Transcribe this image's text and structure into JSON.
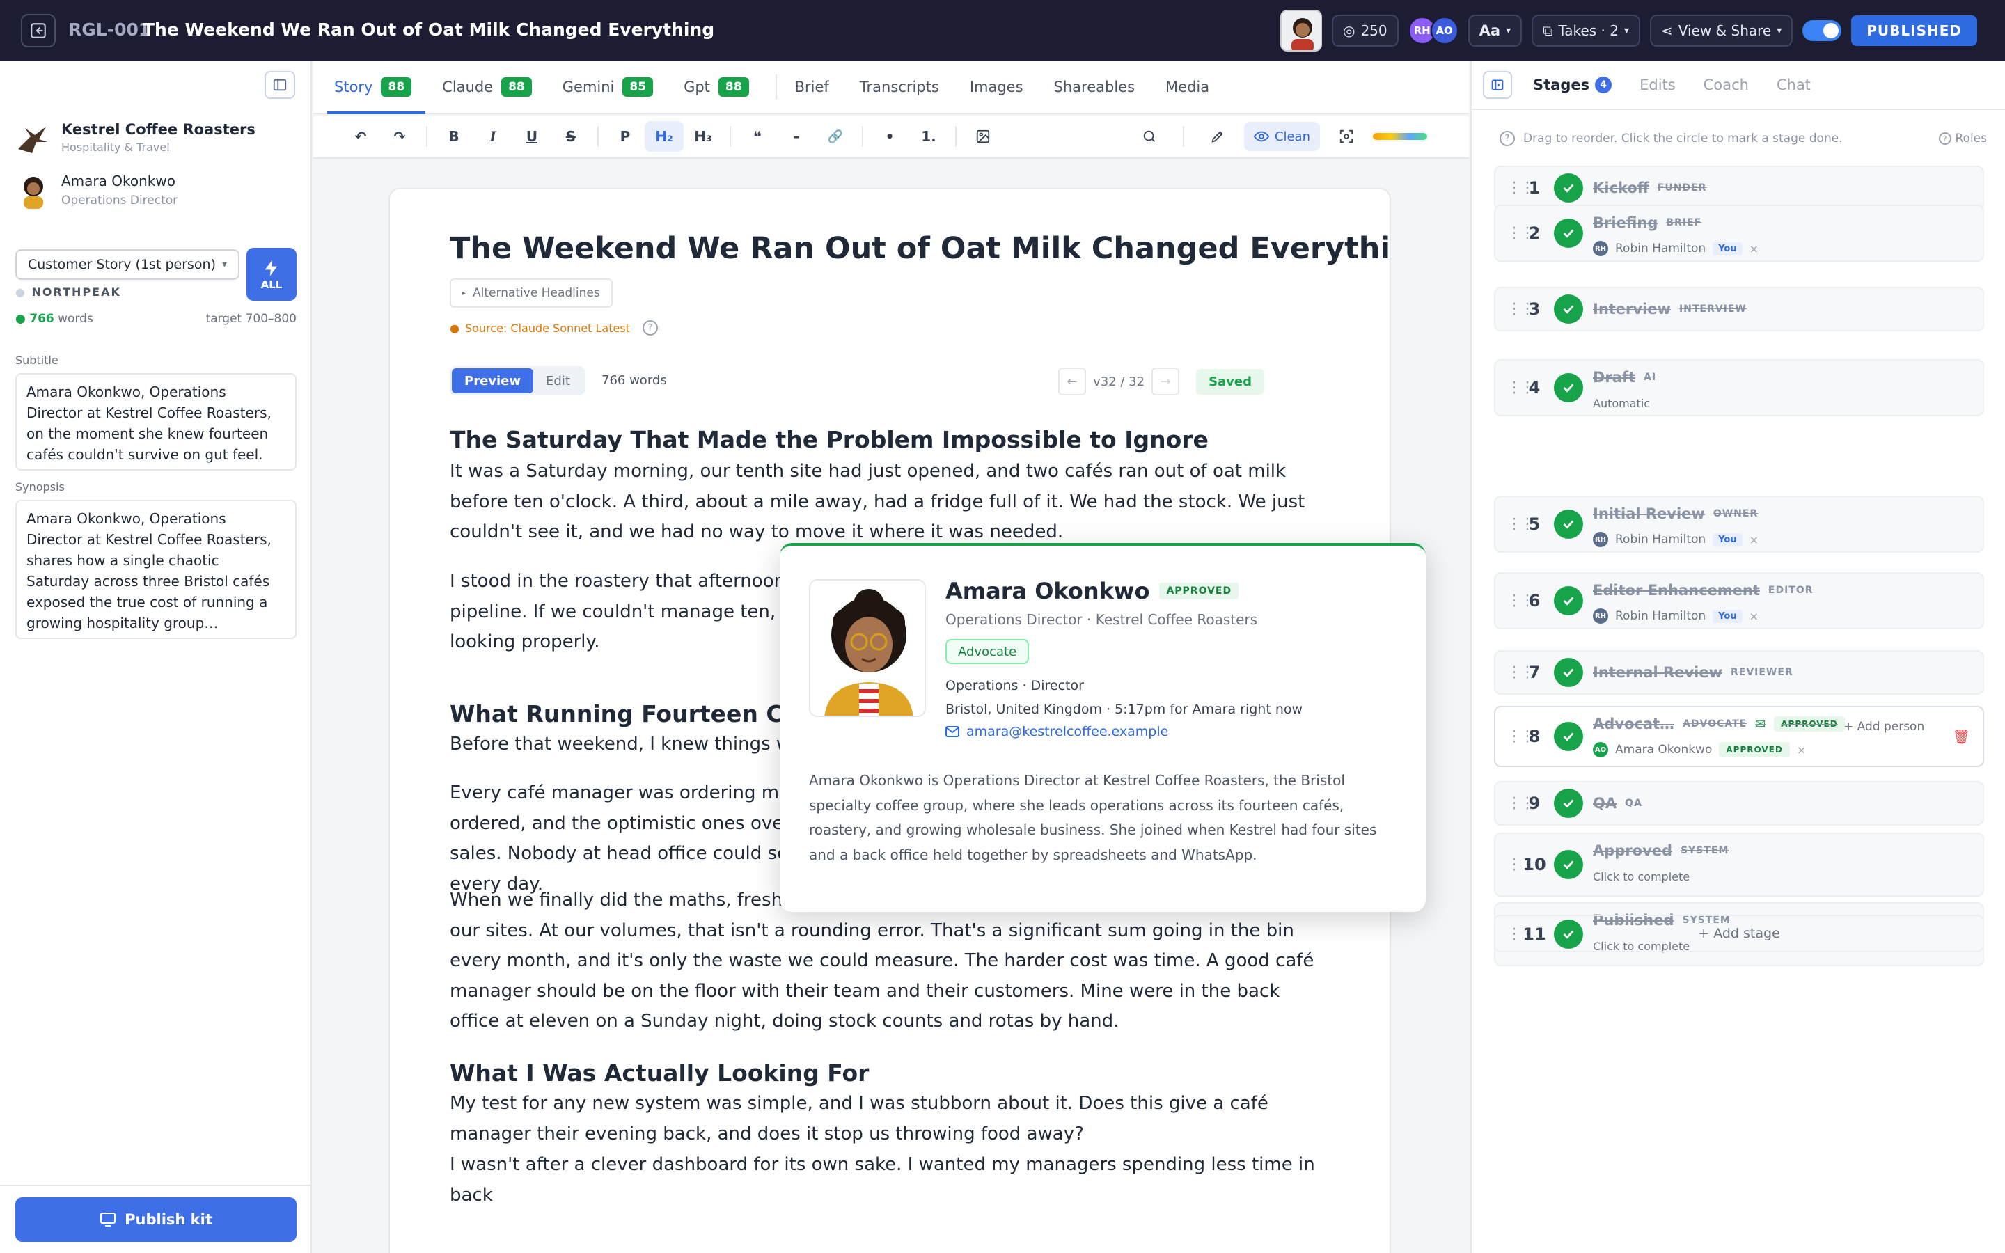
{
  "topbar": {
    "id": "RGL-001",
    "title": "The Weekend We Ran Out of Oat Milk Changed Everything",
    "credits": "250",
    "avatars": [
      "RH",
      "AO"
    ],
    "font_label": "Aa",
    "takes_label": "Takes · 2",
    "share_label": "View & Share",
    "status": "PUBLISHED"
  },
  "sidebar": {
    "org_name": "Kestrel Coffee Roasters",
    "org_sector": "Hospitality & Travel",
    "person_name": "Amara Okonkwo",
    "person_title": "Operations Director",
    "story_type": "Customer Story (1st person)",
    "all_label": "ALL",
    "brand": "NORTHPEAK",
    "word_count": "766",
    "words_label": "words",
    "target": "target 700–800",
    "subtitle_label": "Subtitle",
    "subtitle": "Amara Okonkwo, Operations Director at Kestrel Coffee Roasters, on the moment she knew fourteen cafés couldn't survive on gut feel.",
    "synopsis_label": "Synopsis",
    "synopsis": "Amara Okonkwo, Operations Director at Kestrel Coffee Roasters, shares how a single chaotic Saturday across three Bristol cafés exposed the true cost of running a growing hospitality group…",
    "publish_label": "Publish kit"
  },
  "tabs": [
    {
      "label": "Story",
      "score": "88"
    },
    {
      "label": "Claude",
      "score": "88"
    },
    {
      "label": "Gemini",
      "score": "85"
    },
    {
      "label": "Gpt",
      "score": "88"
    }
  ],
  "subtabs": [
    "Brief",
    "Transcripts",
    "Images",
    "Shareables",
    "Media"
  ],
  "toolbar": {
    "undo": "↶",
    "redo": "↷",
    "bold": "B",
    "italic": "I",
    "underline": "U",
    "strike": "S",
    "para": "P",
    "h2": "H₂",
    "h3": "H₃",
    "quote": "❝",
    "hr": "–",
    "link": "🔗",
    "bullet": "•",
    "ordered": "1.",
    "clean_label": "Clean"
  },
  "doc": {
    "title": "The Weekend We Ran Out of Oat Milk Changed Everything",
    "alt_headlines": "Alternative Headlines",
    "source": "Source: Claude Sonnet Latest",
    "preview_label": "Preview",
    "edit_label": "Edit",
    "word_count": "766 words",
    "version": "v32 / 32",
    "saved": "Saved",
    "h2_1": "The Saturday That Made the Problem Impossible to Ignore",
    "p1": "It was a Saturday morning, our tenth site had just opened, and two cafés ran out of oat milk before ten o'clock. A third, about a mile away, had a fridge full of it. We had the stock. We just couldn't see it, and we had no way to move it where it was needed.",
    "p2": "I stood in the roastery that afternoon and realised that with four more sites already in the pipeline. If we couldn't manage ten, we'd never manage fourteen. That Monday, I started looking properly.",
    "h2_2": "What Running Fourteen Cafés on Gut Feel Actually Cost",
    "p3": "Before that weekend, I knew things weren't right.",
    "p4": "Every café manager was ordering milk and fresh food on instinct. The cautious ones under-ordered, and the optimistic ones over-ordered and threw food away at close. Either way we lost sales. Nobody at head office could see any of it until the waste had already happened, quietly, every day.",
    "p5": "When we finally did the maths, fresh-stock waste was running at over eight percent across all our sites. At our volumes, that isn't a rounding error. That's a significant sum going in the bin every month, and it's only the waste we could measure. The harder cost was time. A good café manager should be on the floor with their team and their customers. Mine were in the back office at eleven on a Sunday night, doing stock counts and rotas by hand.",
    "h2_3": "What I Was Actually Looking For",
    "p6": "My test for any new system was simple, and I was stubborn about it. Does this give a café manager their evening back, and does it stop us throwing food away?",
    "p7": "I wasn't after a clever dashboard for its own sake. I wanted my managers spending less time in back"
  },
  "popup": {
    "name": "Amara Okonkwo",
    "status": "APPROVED",
    "role": "Operations Director · Kestrel Coffee Roasters",
    "tag": "Advocate",
    "dept": "Operations · Director",
    "location": "Bristol, United Kingdom · 5:17pm for Amara right now",
    "email": "amara@kestrelcoffee.example",
    "bio": "Amara Okonkwo is Operations Director at Kestrel Coffee Roasters, the Bristol specialty coffee group, where she leads operations across its fourteen cafés, roastery, and growing wholesale business. She joined when Kestrel had four sites and a back office held together by spreadsheets and WhatsApp."
  },
  "right": {
    "tabs": [
      "Stages",
      "Edits",
      "Coach",
      "Chat"
    ],
    "stage_count": "4",
    "hint": "Drag to reorder. Click the circle to mark a stage done.",
    "roles_label": "Roles",
    "add_person": "+ Add person",
    "add_stage": "+ Add stage",
    "stages": [
      {
        "num": "1",
        "name": "Kickoff",
        "tag": "FUNDER"
      },
      {
        "num": "2",
        "name": "Briefing",
        "tag": "BRIEF",
        "person": "Robin Hamilton",
        "initials": "RH",
        "you": "You"
      },
      {
        "num": "3",
        "name": "Interview",
        "tag": "INTERVIEW"
      },
      {
        "num": "4",
        "name": "Draft",
        "tag": "AI",
        "sub": "Automatic"
      },
      {
        "num": "5",
        "name": "Initial Review",
        "tag": "OWNER",
        "person": "Robin Hamilton",
        "initials": "RH",
        "you": "You"
      },
      {
        "num": "6",
        "name": "Editor Enhancement",
        "tag": "EDITOR",
        "person": "Robin Hamilton",
        "initials": "RH",
        "you": "You"
      },
      {
        "num": "7",
        "name": "Internal Review",
        "tag": "REVIEWER"
      },
      {
        "num": "8",
        "name": "Advocat…",
        "tag": "ADVOCATE",
        "badge": "APPROVED",
        "person": "Amara Okonkwo",
        "initials": "AO",
        "person_badge": "APPROVED"
      },
      {
        "num": "9",
        "name": "QA",
        "tag": "QA"
      },
      {
        "num": "10",
        "name": "Approved",
        "tag": "SYSTEM",
        "sub": "Click to complete"
      },
      {
        "num": "11",
        "name": "Published",
        "tag": "SYSTEM",
        "sub": "Click to complete"
      }
    ]
  }
}
